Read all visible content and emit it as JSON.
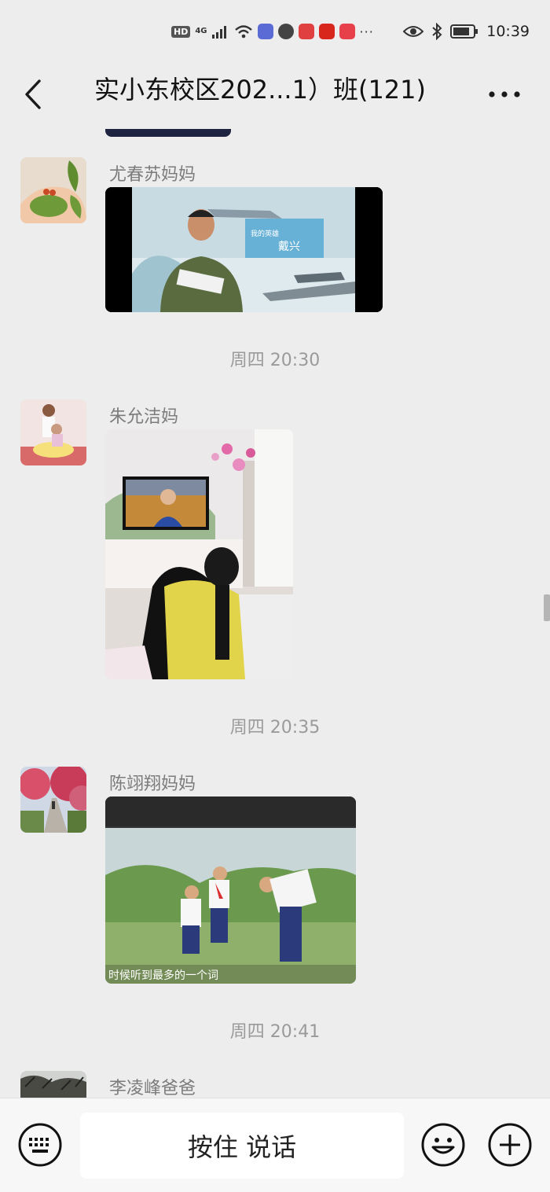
{
  "status_bar": {
    "network_badge": "HD",
    "network_type": "4G",
    "time": "10:39",
    "overflow": "···",
    "icons": [
      "signal-icon",
      "wifi-icon",
      "music-app-icon",
      "browser-app-icon",
      "reader-app-icon",
      "study-app-icon",
      "heart-app-icon",
      "eye-comfort-icon",
      "bluetooth-icon",
      "battery-icon"
    ]
  },
  "header": {
    "title": "实小东校区202...1）班(121)",
    "back_icon": "chevron-left-icon",
    "more_icon": "more-dots-icon"
  },
  "messages": [
    {
      "type": "image",
      "sender": "尤春苏妈妈",
      "image": "TV still: pilot reading a book, jet and aircraft carrier",
      "overlay_text": [
        "我的英雄",
        "戴兴"
      ]
    },
    {
      "type": "time",
      "text": "周四 20:30"
    },
    {
      "type": "image",
      "sender": "朱允洁妈",
      "image": "Child watching TV broadcast in living room",
      "overlay_text": []
    },
    {
      "type": "time",
      "text": "周四 20:35"
    },
    {
      "type": "image",
      "sender": "陈翊翔妈妈",
      "image": "TV still: children planting in a field",
      "overlay_text": [
        "时候听到最多的一个词"
      ]
    },
    {
      "type": "time",
      "text": "周四 20:41"
    },
    {
      "type": "image",
      "sender": "李凌峰爸爸",
      "image": "",
      "overlay_text": []
    }
  ],
  "input_bar": {
    "keyboard_icon": "keyboard-icon",
    "hold_to_talk_label": "按住 说话",
    "emoji_icon": "emoji-icon",
    "plus_icon": "plus-icon"
  },
  "colors": {
    "background": "#ededed",
    "bottom_bar": "#f7f7f7",
    "sender_name": "#7c7c7c",
    "timestamp": "#9a9a9a"
  }
}
